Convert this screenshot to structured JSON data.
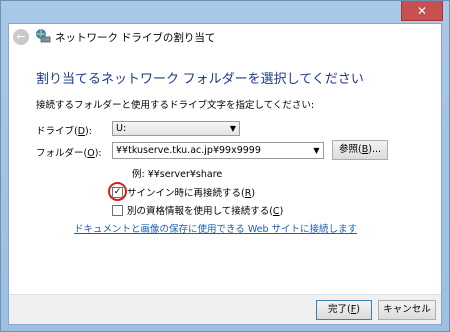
{
  "window": {
    "title": "ネットワーク ドライブの割り当て",
    "close_glyph": "✕"
  },
  "icons": {
    "back": "back-arrow-icon",
    "wizard": "network-drive-icon"
  },
  "page_title": "割り当てるネットワーク フォルダーを選択してください",
  "instruction": "接続するフォルダーと使用するドライブ文字を指定してください:",
  "drive": {
    "label_pre": "ドライブ(",
    "accesskey": "D",
    "label_post": "):",
    "value": "U:"
  },
  "folder": {
    "label_pre": "フォルダー(",
    "accesskey": "O",
    "label_post": "):",
    "value": "¥¥tkuserve.tku.ac.jp¥99x9999",
    "browse_label_pre": "参照(",
    "browse_accesskey": "B",
    "browse_label_post": ")..."
  },
  "example": "例: ¥¥server¥share",
  "reconnect": {
    "label_pre": "サインイン時に再接続する(",
    "accesskey": "R",
    "label_post": ")",
    "checked": true
  },
  "other_credentials": {
    "label_pre": "別の資格情報を使用して接続する(",
    "accesskey": "C",
    "label_post": ")",
    "checked": false
  },
  "link": "ドキュメントと画像の保存に使用できる Web サイトに接続します",
  "footer": {
    "finish_pre": "完了(",
    "finish_accesskey": "F",
    "finish_post": ")",
    "cancel": "キャンセル"
  }
}
